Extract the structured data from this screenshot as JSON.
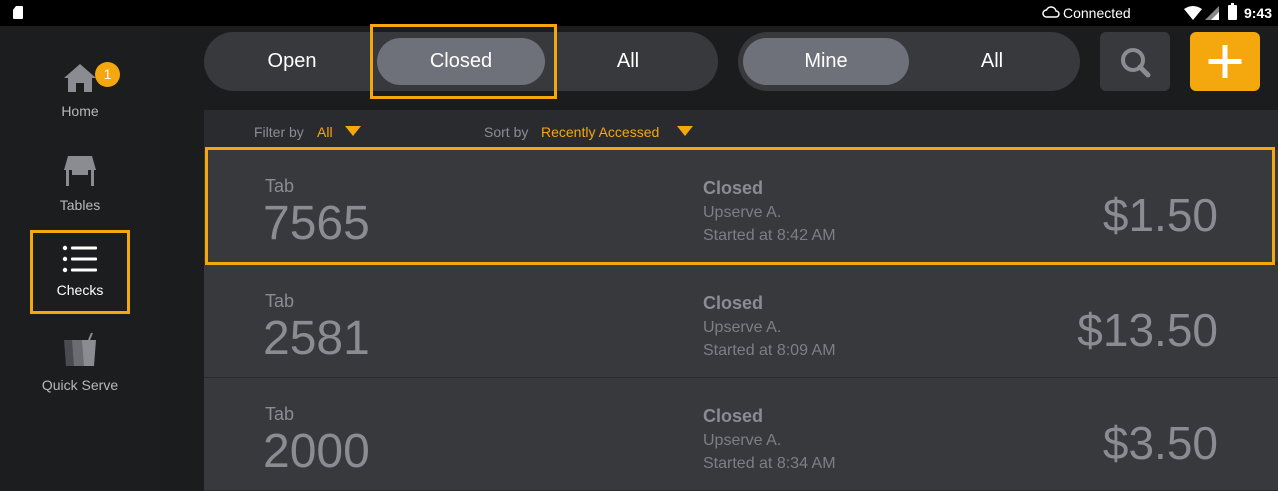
{
  "status_bar": {
    "connection": "Connected",
    "time": "9:43"
  },
  "sidebar": {
    "items": [
      {
        "label": "Home",
        "badge": "1"
      },
      {
        "label": "Tables"
      },
      {
        "label": "Checks"
      },
      {
        "label": "Quick Serve"
      }
    ]
  },
  "toolbar": {
    "status_tabs": [
      "Open",
      "Closed",
      "All"
    ],
    "owner_tabs": [
      "Mine",
      "All"
    ],
    "selected_status": "Closed",
    "selected_owner": "Mine"
  },
  "filters": {
    "filter_label": "Filter by",
    "filter_value": "All",
    "sort_label": "Sort by",
    "sort_value": "Recently Accessed"
  },
  "checks": [
    {
      "tab_label": "Tab",
      "number": "7565",
      "status": "Closed",
      "server": "Upserve A.",
      "started": "Started at 8:42 AM",
      "amount": "$1.50"
    },
    {
      "tab_label": "Tab",
      "number": "2581",
      "status": "Closed",
      "server": "Upserve A.",
      "started": "Started at 8:09 AM",
      "amount": "$13.50"
    },
    {
      "tab_label": "Tab",
      "number": "2000",
      "status": "Closed",
      "server": "Upserve A.",
      "started": "Started at 8:34 AM",
      "amount": "$3.50"
    }
  ],
  "colors": {
    "accent": "#f5a70e",
    "background": "#1b1c1e",
    "row": "#38393d"
  }
}
